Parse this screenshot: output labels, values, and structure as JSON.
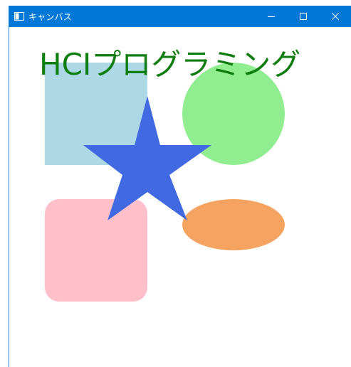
{
  "window": {
    "title": "キャンバス",
    "controls": {
      "minimize_icon": "minimize-icon",
      "maximize_icon": "maximize-icon",
      "close_icon": "close-icon"
    },
    "colors": {
      "titlebar": "#0078d7",
      "titlebar_text": "#ffffff"
    }
  },
  "canvas": {
    "heading": "HCIプログラミング",
    "heading_color": "#0f7d0f",
    "shapes": {
      "square": {
        "shape": "rectangle",
        "fill": "#add8e6"
      },
      "circle": {
        "shape": "circle",
        "fill": "#90ee90"
      },
      "rounded_square": {
        "shape": "rounded-rectangle",
        "fill": "#ffc0cb"
      },
      "ellipse": {
        "shape": "ellipse",
        "fill": "#f4a460"
      },
      "star": {
        "shape": "star",
        "fill": "#4169e1"
      }
    }
  }
}
